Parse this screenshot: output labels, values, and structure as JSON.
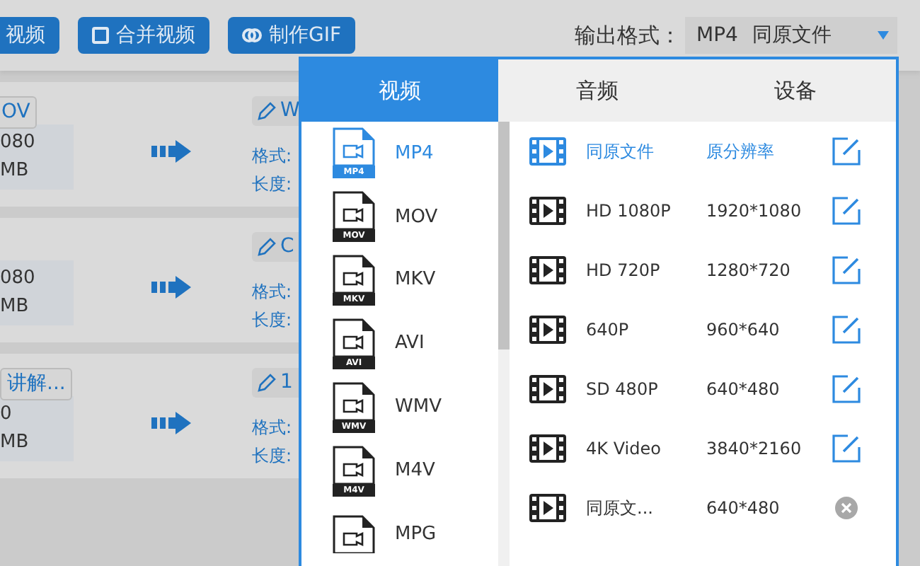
{
  "toolbar": {
    "buttons": [
      {
        "label": "视频",
        "kind": "plain"
      },
      {
        "label": "合并视频",
        "kind": "merge"
      },
      {
        "label": "制作GIF",
        "kind": "gif"
      }
    ],
    "output_format": {
      "label": "输出格式：",
      "format": "MP4",
      "preset": "同原文件"
    }
  },
  "files": [
    {
      "tag": "OV",
      "resolution": "080",
      "size": "MB",
      "name": "W",
      "format_label": "格式:",
      "length_label": "长度:"
    },
    {
      "resolution": "080",
      "size": "MB",
      "name": "C",
      "format_label": "格式:",
      "length_label": "长度:"
    },
    {
      "tag": "讲解...",
      "resolution": "0",
      "size": "MB",
      "name": "1",
      "format_label": "格式:",
      "length_label": "长度:"
    }
  ],
  "format_panel": {
    "tabs": [
      {
        "label": "视频",
        "selected": true
      },
      {
        "label": "音频",
        "selected": false
      },
      {
        "label": "设备",
        "selected": false
      }
    ],
    "formats": [
      {
        "label": "MP4",
        "badge": "MP4",
        "selected": true
      },
      {
        "label": "MOV",
        "badge": "MOV",
        "selected": false
      },
      {
        "label": "MKV",
        "badge": "MKV",
        "selected": false
      },
      {
        "label": "AVI",
        "badge": "AVI",
        "selected": false
      },
      {
        "label": "WMV",
        "badge": "WMV",
        "selected": false
      },
      {
        "label": "M4V",
        "badge": "M4V",
        "selected": false
      },
      {
        "label": "MPG",
        "selected": false
      }
    ],
    "presets": [
      {
        "name": "同原文件",
        "resolution": "原分辨率",
        "selected": true,
        "kind": "edit"
      },
      {
        "name": "HD 1080P",
        "resolution": "1920*1080",
        "selected": false,
        "kind": "edit"
      },
      {
        "name": "HD 720P",
        "resolution": "1280*720",
        "selected": false,
        "kind": "edit"
      },
      {
        "name": "640P",
        "resolution": "960*640",
        "selected": false,
        "kind": "edit"
      },
      {
        "name": "SD 480P",
        "resolution": "640*480",
        "selected": false,
        "kind": "edit"
      },
      {
        "name": "4K Video",
        "resolution": "3840*2160",
        "selected": false,
        "kind": "edit"
      },
      {
        "name": "同原文...",
        "resolution": "640*480",
        "selected": false,
        "kind": "delete"
      }
    ]
  }
}
